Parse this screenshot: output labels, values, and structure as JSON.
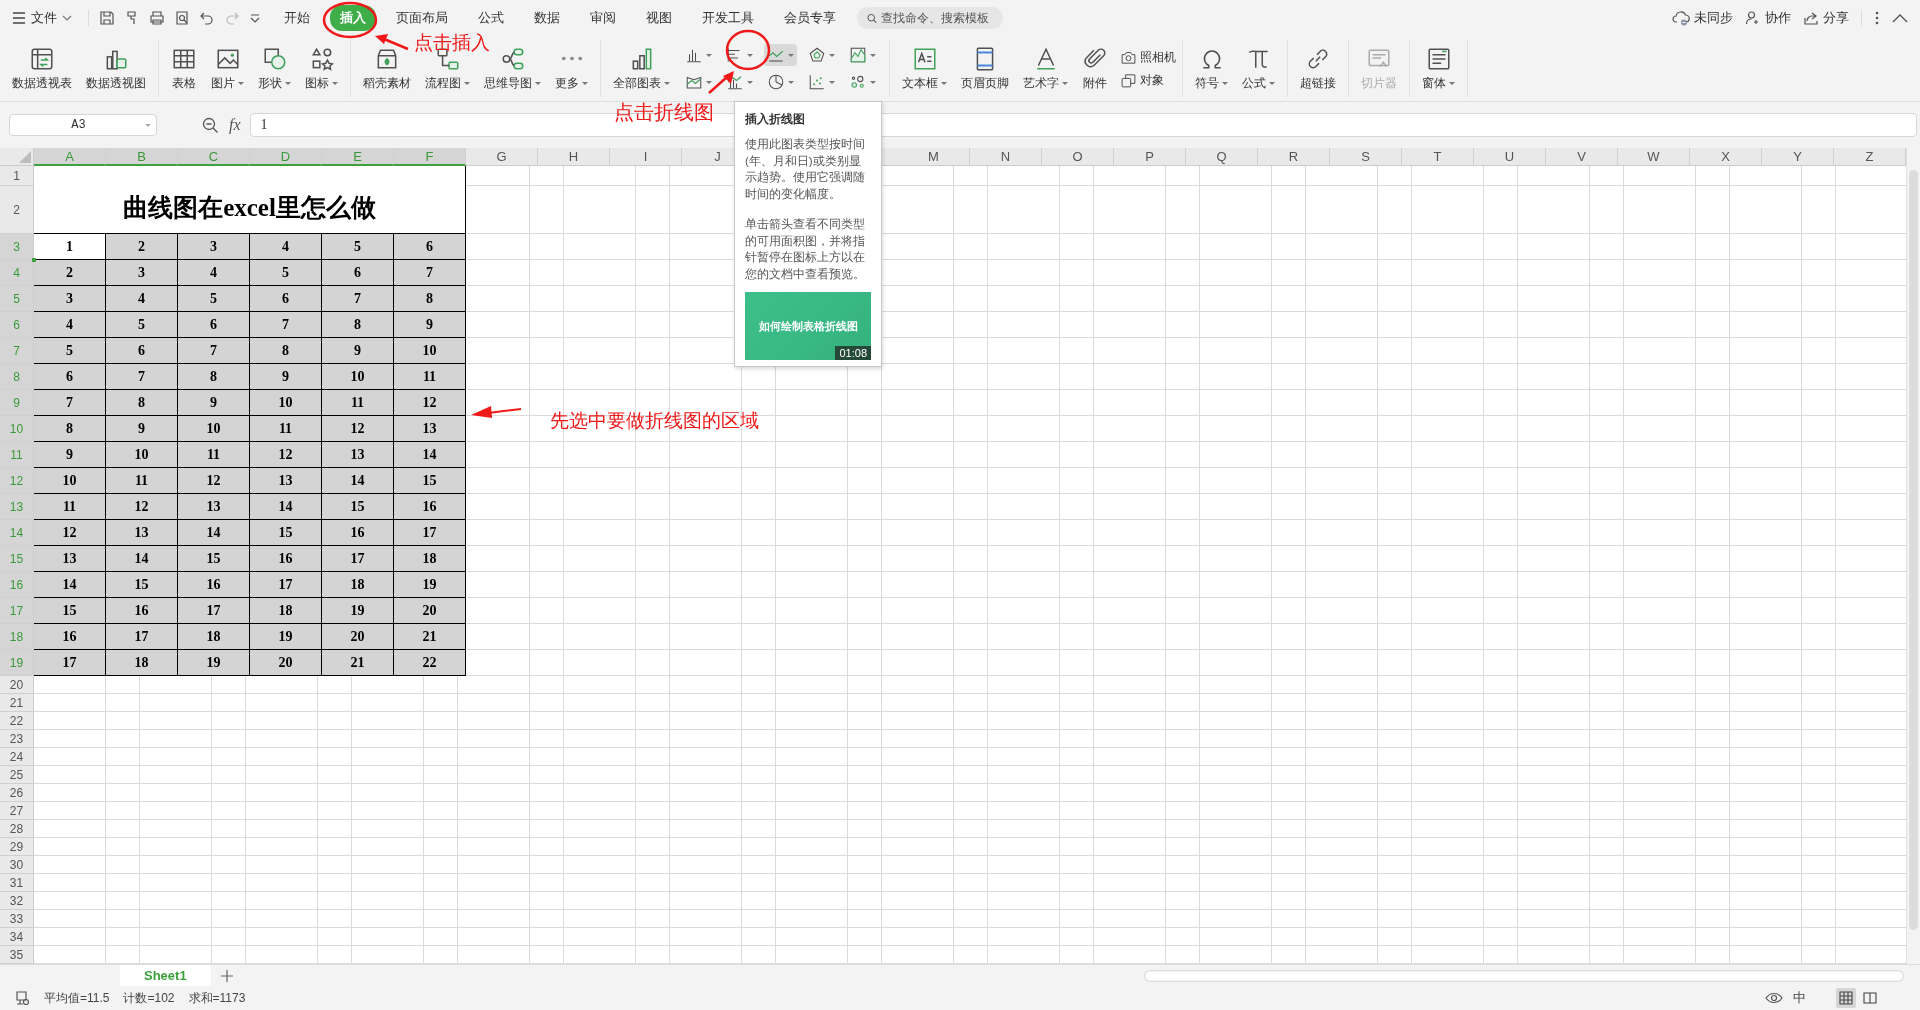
{
  "menu_bar": {
    "file_menu": "文件",
    "tabs": [
      {
        "label": "开始",
        "selected": false
      },
      {
        "label": "插入",
        "selected": true
      },
      {
        "label": "页面布局",
        "selected": false
      },
      {
        "label": "公式",
        "selected": false
      },
      {
        "label": "数据",
        "selected": false
      },
      {
        "label": "审阅",
        "selected": false
      },
      {
        "label": "视图",
        "selected": false
      },
      {
        "label": "开发工具",
        "selected": false
      },
      {
        "label": "会员专享",
        "selected": false
      }
    ],
    "search": {
      "placeholder": "查找命令、搜索模板"
    },
    "actions": [
      "未同步",
      "协作",
      "分享"
    ]
  },
  "ribbon": {
    "groups": [
      {
        "items": [
          {
            "label": "数据透视表",
            "dropdown": false,
            "disabled": false
          },
          {
            "label": "数据透视图",
            "dropdown": false,
            "disabled": false
          }
        ]
      },
      {
        "items": [
          {
            "label": "表格",
            "dropdown": false,
            "disabled": false
          },
          {
            "label": "图片",
            "dropdown": true,
            "disabled": false
          },
          {
            "label": "形状",
            "dropdown": true,
            "disabled": false
          },
          {
            "label": "图标",
            "dropdown": true,
            "disabled": false
          }
        ]
      },
      {
        "items": [
          {
            "label": "稻壳素材",
            "dropdown": false,
            "disabled": false
          },
          {
            "label": "流程图",
            "dropdown": true,
            "disabled": false
          },
          {
            "label": "思维导图",
            "dropdown": true,
            "disabled": false
          },
          {
            "label": "更多",
            "dropdown": true,
            "disabled": false
          }
        ]
      },
      {
        "items": [
          {
            "label": "全部图表",
            "dropdown": true,
            "disabled": false
          }
        ],
        "grid": [
          {
            "highlighted": false
          },
          {
            "highlighted": false
          },
          {
            "highlighted": true
          },
          {
            "highlighted": false
          },
          {
            "highlighted": false
          },
          {
            "highlighted": false
          },
          {
            "highlighted": false
          },
          {
            "highlighted": false
          },
          {
            "highlighted": false
          },
          {
            "highlighted": false
          }
        ]
      },
      {
        "items": [
          {
            "label": "文本框",
            "dropdown": true,
            "disabled": false
          },
          {
            "label": "页眉页脚",
            "dropdown": false,
            "disabled": false
          },
          {
            "label": "艺术字",
            "dropdown": true,
            "disabled": false
          },
          {
            "label": "附件",
            "dropdown": false,
            "disabled": false
          }
        ],
        "stack": [
          "照相机",
          "对象"
        ]
      },
      {
        "items": [
          {
            "label": "符号",
            "dropdown": true,
            "disabled": false
          },
          {
            "label": "公式",
            "dropdown": true,
            "disabled": false
          }
        ]
      },
      {
        "items": [
          {
            "label": "超链接",
            "dropdown": false,
            "disabled": false
          }
        ]
      },
      {
        "items": [
          {
            "label": "切片器",
            "dropdown": false,
            "disabled": true
          }
        ]
      },
      {
        "items": [
          {
            "label": "窗体",
            "dropdown": true,
            "disabled": false
          }
        ]
      }
    ]
  },
  "formula_bar": {
    "name_box": "A3",
    "function_button": "fx",
    "formula": "1"
  },
  "sheet": {
    "columns": [
      {
        "label": "A",
        "selected": true
      },
      {
        "label": "B",
        "selected": true
      },
      {
        "label": "C",
        "selected": true
      },
      {
        "label": "D",
        "selected": true
      },
      {
        "label": "E",
        "selected": true
      },
      {
        "label": "F",
        "selected": true
      },
      {
        "label": "G",
        "selected": false
      },
      {
        "label": "H",
        "selected": false
      },
      {
        "label": "I",
        "selected": false
      },
      {
        "label": "J",
        "selected": false
      },
      {},
      {},
      {
        "label": "M",
        "selected": false
      },
      {
        "label": "N",
        "selected": false
      },
      {
        "label": "O",
        "selected": false
      },
      {
        "label": "P",
        "selected": false
      },
      {
        "label": "Q",
        "selected": false
      },
      {
        "label": "R",
        "selected": false
      },
      {
        "label": "S",
        "selected": false
      },
      {
        "label": "T",
        "selected": false
      },
      {
        "label": "U",
        "selected": false
      },
      {
        "label": "V",
        "selected": false
      },
      {
        "label": "W",
        "selected": false
      },
      {
        "label": "X",
        "selected": false
      },
      {
        "label": "Y",
        "selected": false
      },
      {
        "label": "Z",
        "selected": false
      }
    ],
    "rows": [
      {
        "label": "1",
        "selected": false
      },
      {
        "label": "2",
        "selected": false
      },
      {
        "label": "3",
        "selected": true
      },
      {
        "label": "4",
        "selected": true
      },
      {
        "label": "5",
        "selected": true
      },
      {
        "label": "6",
        "selected": true
      },
      {
        "label": "7",
        "selected": true
      },
      {
        "label": "8",
        "selected": true
      },
      {
        "label": "9",
        "selected": true
      },
      {
        "label": "10",
        "selected": true
      },
      {
        "label": "11",
        "selected": true
      },
      {
        "label": "12",
        "selected": true
      },
      {
        "label": "13",
        "selected": true
      },
      {
        "label": "14",
        "selected": true
      },
      {
        "label": "15",
        "selected": true
      },
      {
        "label": "16",
        "selected": true
      },
      {
        "label": "17",
        "selected": true
      },
      {
        "label": "18",
        "selected": true
      },
      {
        "label": "19",
        "selected": true
      },
      {
        "label": "20",
        "selected": false
      },
      {
        "label": "21",
        "selected": false
      },
      {
        "label": "22",
        "selected": false
      },
      {
        "label": "23",
        "selected": false
      },
      {
        "label": "24",
        "selected": false
      },
      {
        "label": "25",
        "selected": false
      },
      {
        "label": "26",
        "selected": false
      },
      {
        "label": "27",
        "selected": false
      },
      {
        "label": "28",
        "selected": false
      },
      {
        "label": "29",
        "selected": false
      },
      {
        "label": "30",
        "selected": false
      },
      {
        "label": "31",
        "selected": false
      },
      {
        "label": "32",
        "selected": false
      },
      {
        "label": "33",
        "selected": false
      },
      {
        "label": "34",
        "selected": false
      },
      {
        "label": "35",
        "selected": false
      }
    ],
    "title": "曲线图在excel里怎么做",
    "data": [
      [
        {
          "value": "1",
          "active": true
        },
        {
          "value": "2",
          "active": false
        },
        {
          "value": "3",
          "active": false
        },
        {
          "value": "4",
          "active": false
        },
        {
          "value": "5",
          "active": false
        },
        {
          "value": "6",
          "active": false
        }
      ],
      [
        {
          "value": "2",
          "active": false
        },
        {
          "value": "3",
          "active": false
        },
        {
          "value": "4",
          "active": false
        },
        {
          "value": "5",
          "active": false
        },
        {
          "value": "6",
          "active": false
        },
        {
          "value": "7",
          "active": false
        }
      ],
      [
        {
          "value": "3",
          "active": false
        },
        {
          "value": "4",
          "active": false
        },
        {
          "value": "5",
          "active": false
        },
        {
          "value": "6",
          "active": false
        },
        {
          "value": "7",
          "active": false
        },
        {
          "value": "8",
          "active": false
        }
      ],
      [
        {
          "value": "4",
          "active": false
        },
        {
          "value": "5",
          "active": false
        },
        {
          "value": "6",
          "active": false
        },
        {
          "value": "7",
          "active": false
        },
        {
          "value": "8",
          "active": false
        },
        {
          "value": "9",
          "active": false
        }
      ],
      [
        {
          "value": "5",
          "active": false
        },
        {
          "value": "6",
          "active": false
        },
        {
          "value": "7",
          "active": false
        },
        {
          "value": "8",
          "active": false
        },
        {
          "value": "9",
          "active": false
        },
        {
          "value": "10",
          "active": false
        }
      ],
      [
        {
          "value": "6",
          "active": false
        },
        {
          "value": "7",
          "active": false
        },
        {
          "value": "8",
          "active": false
        },
        {
          "value": "9",
          "active": false
        },
        {
          "value": "10",
          "active": false
        },
        {
          "value": "11",
          "active": false
        }
      ],
      [
        {
          "value": "7",
          "active": false
        },
        {
          "value": "8",
          "active": false
        },
        {
          "value": "9",
          "active": false
        },
        {
          "value": "10",
          "active": false
        },
        {
          "value": "11",
          "active": false
        },
        {
          "value": "12",
          "active": false
        }
      ],
      [
        {
          "value": "8",
          "active": false
        },
        {
          "value": "9",
          "active": false
        },
        {
          "value": "10",
          "active": false
        },
        {
          "value": "11",
          "active": false
        },
        {
          "value": "12",
          "active": false
        },
        {
          "value": "13",
          "active": false
        }
      ],
      [
        {
          "value": "9",
          "active": false
        },
        {
          "value": "10",
          "active": false
        },
        {
          "value": "11",
          "active": false
        },
        {
          "value": "12",
          "active": false
        },
        {
          "value": "13",
          "active": false
        },
        {
          "value": "14",
          "active": false
        }
      ],
      [
        {
          "value": "10",
          "active": false
        },
        {
          "value": "11",
          "active": false
        },
        {
          "value": "12",
          "active": false
        },
        {
          "value": "13",
          "active": false
        },
        {
          "value": "14",
          "active": false
        },
        {
          "value": "15",
          "active": false
        }
      ],
      [
        {
          "value": "11",
          "active": false
        },
        {
          "value": "12",
          "active": false
        },
        {
          "value": "13",
          "active": false
        },
        {
          "value": "14",
          "active": false
        },
        {
          "value": "15",
          "active": false
        },
        {
          "value": "16",
          "active": false
        }
      ],
      [
        {
          "value": "12",
          "active": false
        },
        {
          "value": "13",
          "active": false
        },
        {
          "value": "14",
          "active": false
        },
        {
          "value": "15",
          "active": false
        },
        {
          "value": "16",
          "active": false
        },
        {
          "value": "17",
          "active": false
        }
      ],
      [
        {
          "value": "13",
          "active": false
        },
        {
          "value": "14",
          "active": false
        },
        {
          "value": "15",
          "active": false
        },
        {
          "value": "16",
          "active": false
        },
        {
          "value": "17",
          "active": false
        },
        {
          "value": "18",
          "active": false
        }
      ],
      [
        {
          "value": "14",
          "active": false
        },
        {
          "value": "15",
          "active": false
        },
        {
          "value": "16",
          "active": false
        },
        {
          "value": "17",
          "active": false
        },
        {
          "value": "18",
          "active": false
        },
        {
          "value": "19",
          "active": false
        }
      ],
      [
        {
          "value": "15",
          "active": false
        },
        {
          "value": "16",
          "active": false
        },
        {
          "value": "17",
          "active": false
        },
        {
          "value": "18",
          "active": false
        },
        {
          "value": "19",
          "active": false
        },
        {
          "value": "20",
          "active": false
        }
      ],
      [
        {
          "value": "16",
          "active": false
        },
        {
          "value": "17",
          "active": false
        },
        {
          "value": "18",
          "active": false
        },
        {
          "value": "19",
          "active": false
        },
        {
          "value": "20",
          "active": false
        },
        {
          "value": "21",
          "active": false
        }
      ],
      [
        {
          "value": "17",
          "active": false
        },
        {
          "value": "18",
          "active": false
        },
        {
          "value": "19",
          "active": false
        },
        {
          "value": "20",
          "active": false
        },
        {
          "value": "21",
          "active": false
        },
        {
          "value": "22",
          "active": false
        }
      ]
    ]
  },
  "tooltip": {
    "title": "插入折线图",
    "paragraphs": [
      "使用此图表类型按时间(年、月和日)或类别显示趋势。使用它强调随时间的变化幅度。",
      "单击箭头查看不同类型的可用面积图，并将指针暂停在图标上方以在您的文档中查看预览。"
    ],
    "video": {
      "title": "如何绘制表格折线图",
      "duration": "01:08"
    }
  },
  "sheet_tabs": [
    {
      "label": "Sheet1",
      "selected": true
    }
  ],
  "status_bar": {
    "stats": [
      "平均值=11.5",
      "计数=102",
      "求和=1173"
    ],
    "input_mode": "中",
    "views": [
      {
        "selected": true
      },
      {
        "selected": false
      }
    ]
  },
  "annotations": [
    {
      "text": "点击插入"
    },
    {
      "text": "点击折线图"
    },
    {
      "text": "先选中要做折线图的区域"
    }
  ]
}
